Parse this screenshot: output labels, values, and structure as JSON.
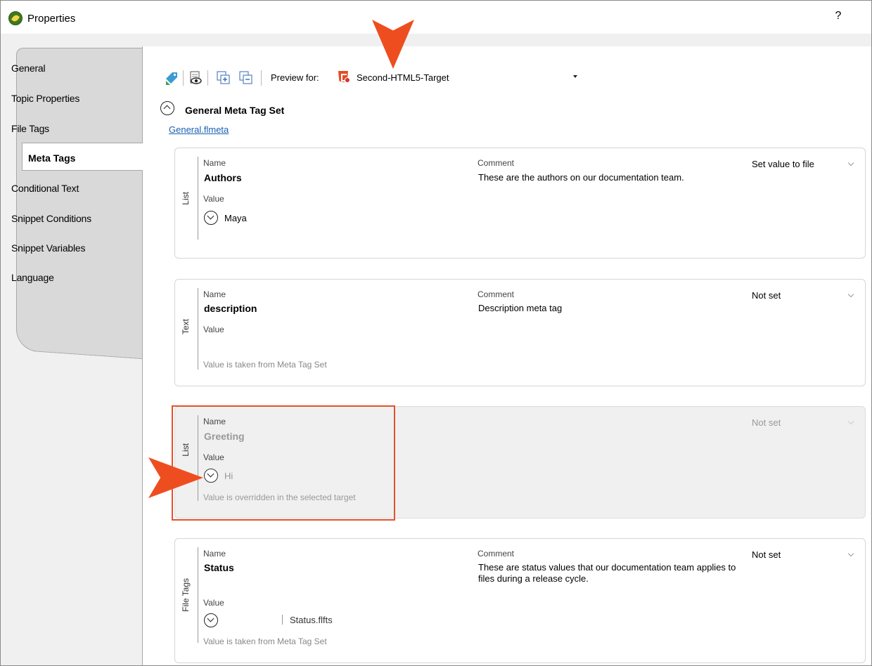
{
  "window": {
    "title": "Properties",
    "help": "?"
  },
  "tabs": [
    {
      "label": "General"
    },
    {
      "label": "Topic Properties"
    },
    {
      "label": "File Tags"
    },
    {
      "label": "Meta Tags",
      "active": true
    },
    {
      "label": "Conditional Text"
    },
    {
      "label": "Snippet Conditions"
    },
    {
      "label": "Snippet Variables"
    },
    {
      "label": "Language"
    }
  ],
  "toolbar": {
    "preview_label": "Preview for:",
    "preview_target": "Second-HTML5-Target"
  },
  "meta_tag_set": {
    "title": "General Meta Tag Set",
    "file_link": "General.flmeta"
  },
  "labels": {
    "name": "Name",
    "comment": "Comment",
    "value": "Value"
  },
  "tags": [
    {
      "type": "List",
      "name": "Authors",
      "comment": "These are the authors on our documentation team.",
      "state": "Set value to file",
      "value": "Maya",
      "hint": ""
    },
    {
      "type": "Text",
      "name": "description",
      "comment": "Description meta tag",
      "state": "Not set",
      "value": "",
      "hint": "Value is taken from Meta Tag Set"
    },
    {
      "type": "List",
      "name": "Greeting",
      "comment": "",
      "state": "Not set",
      "value": "Hi",
      "hint": "Value is overridden in the selected target"
    },
    {
      "type": "File Tags",
      "name": "Status",
      "comment": "These are status values that our documentation team applies to files during a release cycle.",
      "state": "Not set",
      "value": "",
      "file": "Status.flfts",
      "hint": "Value is taken from Meta Tag Set"
    }
  ],
  "colors": {
    "callout": "#ee4e1f",
    "highlight_border": "#e2532a",
    "link": "#1a5fb4"
  }
}
